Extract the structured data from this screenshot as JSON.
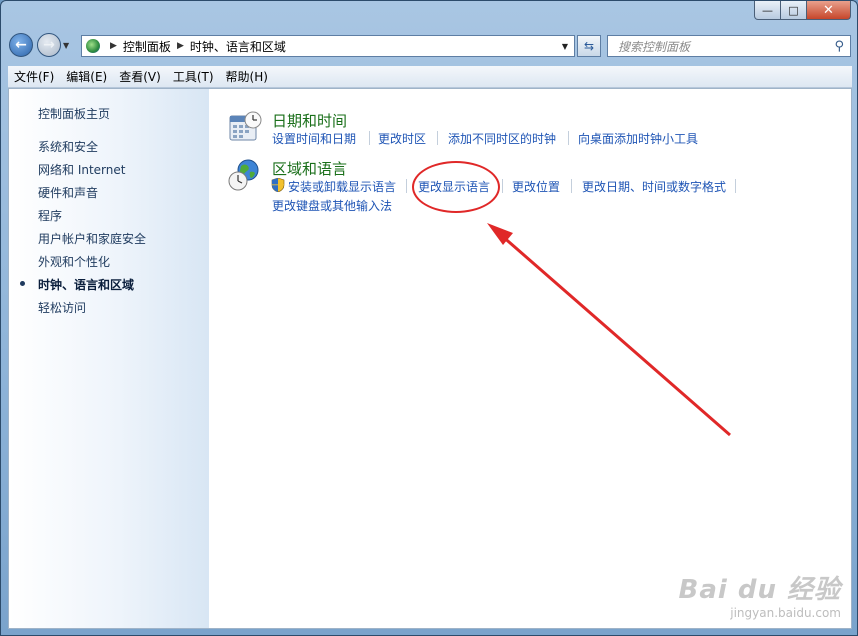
{
  "window": {
    "min_label": "—",
    "max_label": "□",
    "close_label": "✕"
  },
  "address": {
    "crumbs": [
      "控制面板",
      "时钟、语言和区域"
    ]
  },
  "search": {
    "placeholder": "搜索控制面板"
  },
  "menu": [
    "文件(F)",
    "编辑(E)",
    "查看(V)",
    "工具(T)",
    "帮助(H)"
  ],
  "sidebar": {
    "items": [
      "控制面板主页",
      "系统和安全",
      "网络和 Internet",
      "硬件和声音",
      "程序",
      "用户帐户和家庭安全",
      "外观和个性化",
      "时钟、语言和区域",
      "轻松访问"
    ],
    "active_index": 7
  },
  "categories": [
    {
      "title": "日期和时间",
      "icon": "calendar-clock-icon",
      "links": [
        "设置时间和日期",
        "更改时区",
        "添加不同时区的时钟",
        "向桌面添加时钟小工具"
      ]
    },
    {
      "title": "区域和语言",
      "icon": "globe-clock-icon",
      "links": [
        "安装或卸载显示语言",
        "更改显示语言",
        "更改位置",
        "更改日期、时间或数字格式",
        "更改键盘或其他输入法"
      ]
    }
  ],
  "watermark": {
    "brand": "Bai du 经验",
    "url": "jingyan.baidu.com"
  },
  "colors": {
    "link": "#1f55b5",
    "category_title": "#1a6f1a",
    "annotation": "#e02828"
  }
}
